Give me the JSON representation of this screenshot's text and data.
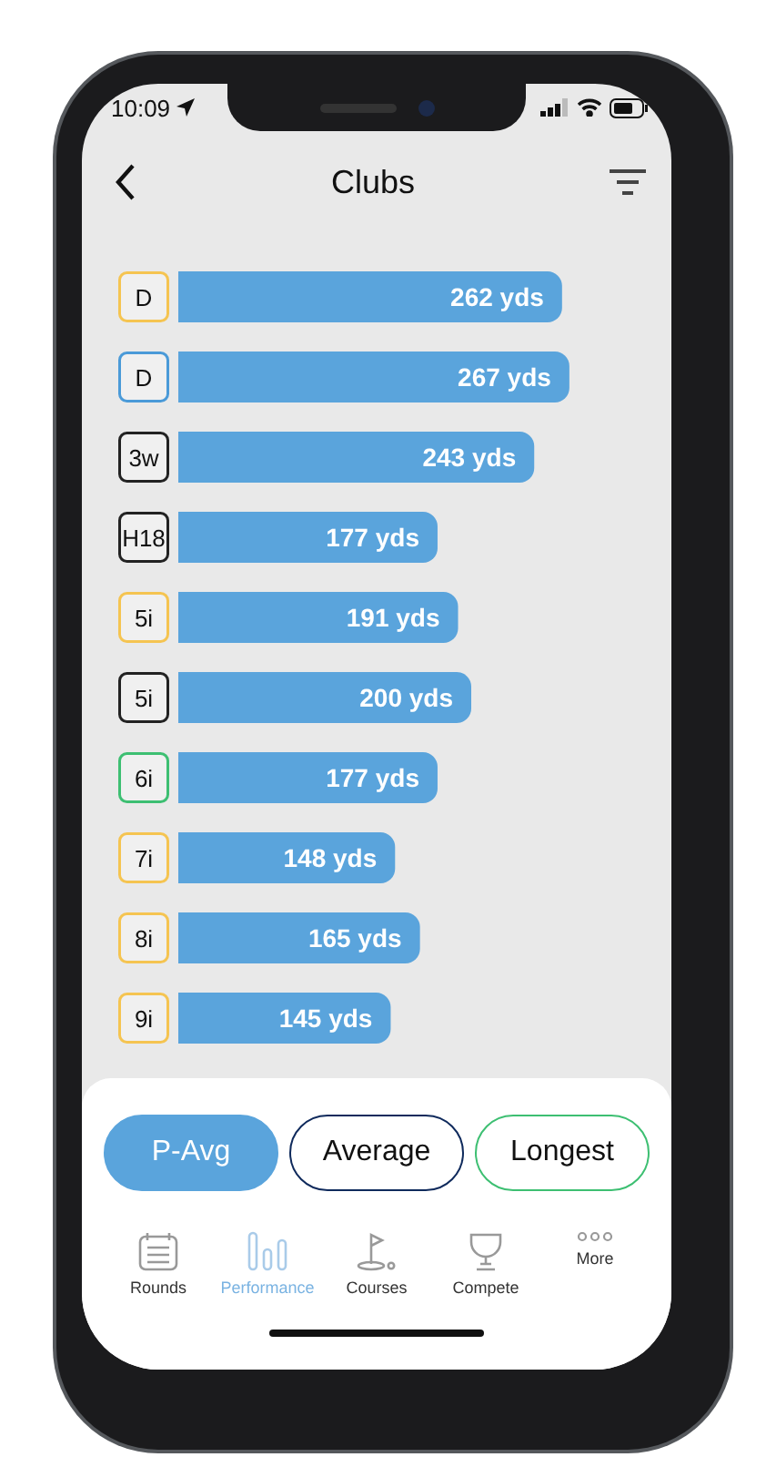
{
  "status_bar": {
    "time": "10:09"
  },
  "header": {
    "title": "Clubs"
  },
  "clubs": {
    "chart_data": {
      "type": "bar",
      "orientation": "horizontal",
      "categories": [
        "D",
        "D",
        "3w",
        "H18",
        "5i",
        "5i",
        "6i",
        "7i",
        "8i",
        "9i"
      ],
      "values": [
        262,
        267,
        243,
        177,
        191,
        200,
        177,
        148,
        165,
        145
      ],
      "value_labels": [
        "262 yds",
        "267 yds",
        "243 yds",
        "177 yds",
        "191 yds",
        "200 yds",
        "177 yds",
        "148 yds",
        "165 yds",
        "145 yds"
      ]
    },
    "badges": [
      {
        "color": "#f5c451"
      },
      {
        "color": "#4a9ad8"
      },
      {
        "color": "#222222"
      },
      {
        "color": "#222222"
      },
      {
        "color": "#f5c451"
      },
      {
        "color": "#222222"
      },
      {
        "color": "#3dbf72"
      },
      {
        "color": "#f5c451"
      },
      {
        "color": "#f5c451"
      },
      {
        "color": "#f5c451"
      }
    ]
  },
  "modes": [
    {
      "label": "P-Avg",
      "selected": true,
      "color": "#5aa4dc"
    },
    {
      "label": "Average",
      "selected": false,
      "color": "#0f2a5c"
    },
    {
      "label": "Longest",
      "selected": false,
      "color": "#3dbf72"
    }
  ],
  "tab_bar": [
    {
      "kind": "rounds",
      "label": "Rounds",
      "selected": false
    },
    {
      "kind": "performance",
      "label": "Performance",
      "selected": true
    },
    {
      "kind": "courses",
      "label": "Courses",
      "selected": false
    },
    {
      "kind": "compete",
      "label": "Compete",
      "selected": false
    },
    {
      "kind": "more",
      "label": "More",
      "selected": false
    }
  ]
}
